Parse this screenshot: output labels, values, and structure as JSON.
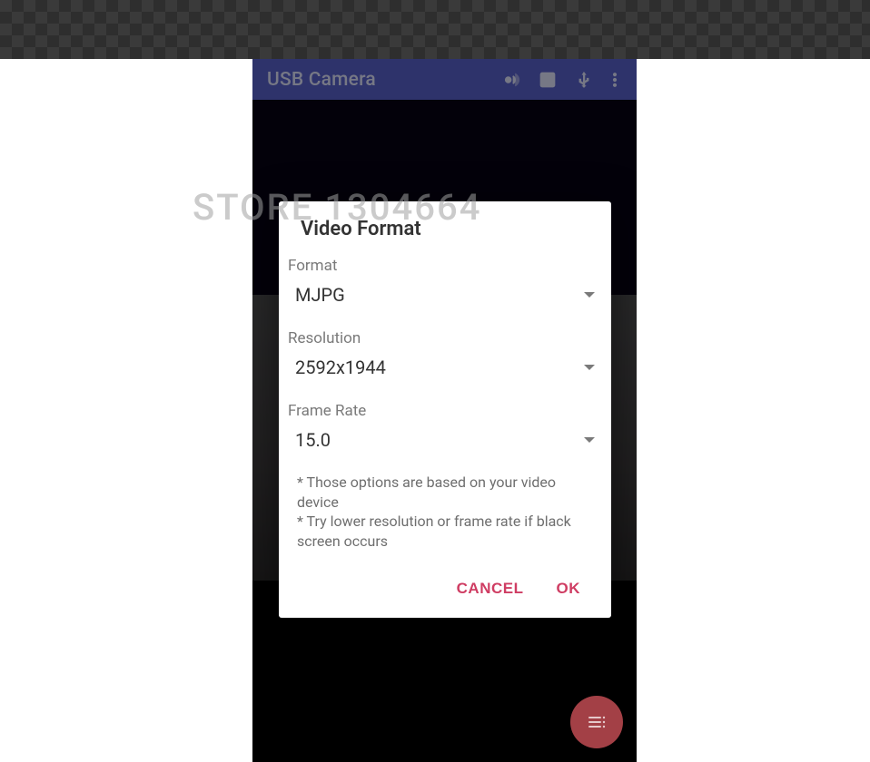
{
  "watermark": "STORE 1304664",
  "appbar": {
    "title": "USB Camera",
    "icons": {
      "motion": "motion-icon",
      "exposure": "exposure-icon",
      "usb": "usb-icon",
      "more": "more-vert-icon"
    }
  },
  "dialog": {
    "title": "Video Format",
    "format": {
      "label": "Format",
      "value": "MJPG"
    },
    "resolution": {
      "label": "Resolution",
      "value": "2592x1944"
    },
    "framerate": {
      "label": "Frame Rate",
      "value": "15.0"
    },
    "hint1": "* Those options are based on your video device",
    "hint2": "* Try lower resolution or frame rate if black screen occurs",
    "cancel": "CANCEL",
    "ok": "OK"
  },
  "accent_color": "#cf3d63"
}
